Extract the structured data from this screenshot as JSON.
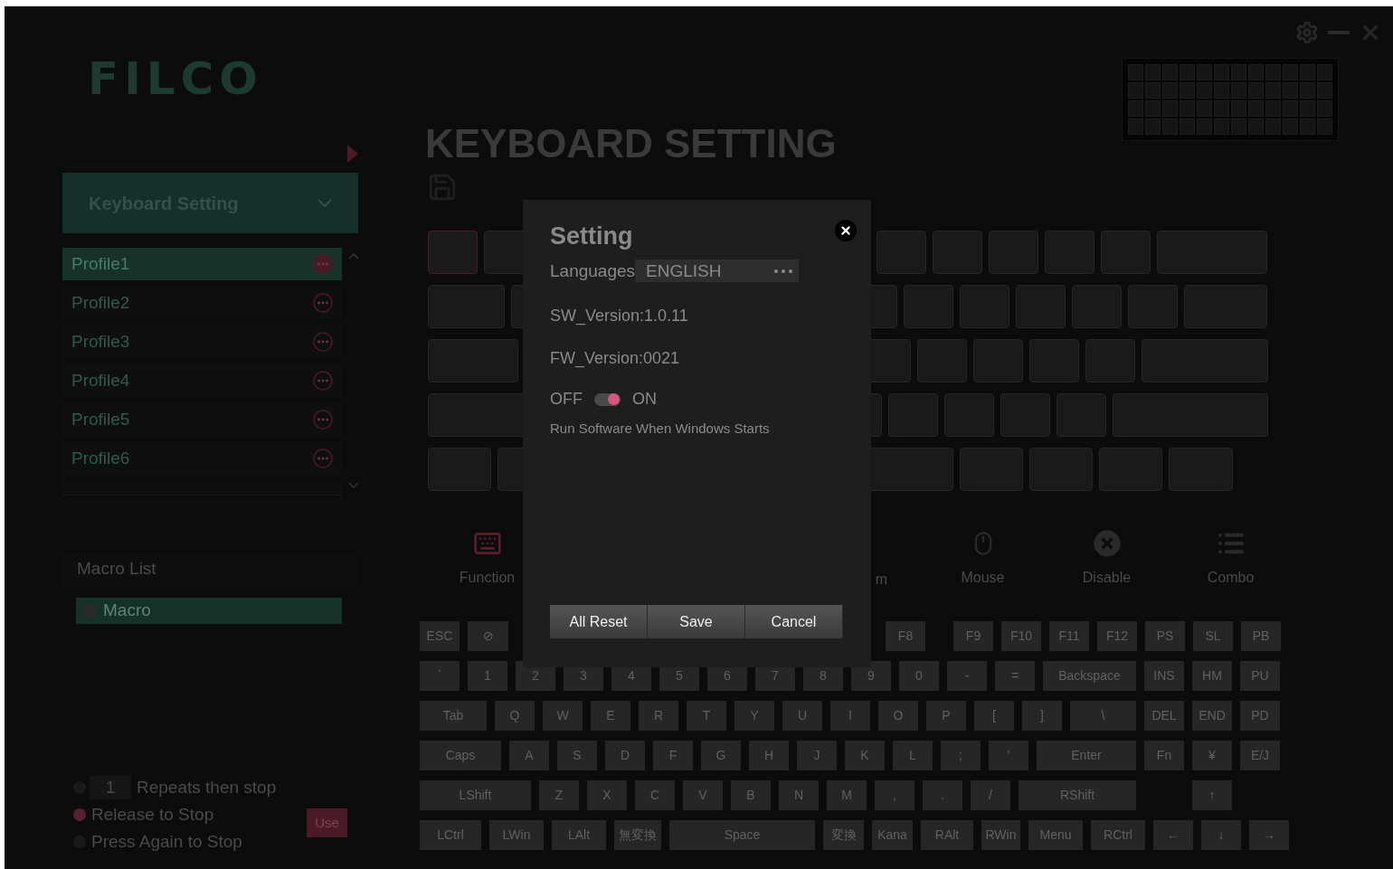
{
  "logo": "FILCO",
  "nav_dropdown": {
    "label": "Keyboard Setting"
  },
  "profiles": [
    {
      "name": "Profile1",
      "selected": true
    },
    {
      "name": "Profile2",
      "selected": false
    },
    {
      "name": "Profile3",
      "selected": false
    },
    {
      "name": "Profile4",
      "selected": false
    },
    {
      "name": "Profile5",
      "selected": false
    },
    {
      "name": "Profile6",
      "selected": false
    }
  ],
  "macro_list": {
    "title": "Macro List",
    "items": [
      {
        "name": "Macro",
        "selected": true
      }
    ]
  },
  "repeat_options": [
    {
      "kind": "count",
      "value": "1",
      "label": "Repeats then stop",
      "selected": false
    },
    {
      "kind": "plain",
      "label": "Release to Stop",
      "selected": true
    },
    {
      "kind": "plain",
      "label": "Press Again to Stop",
      "selected": false
    }
  ],
  "use_button": "Use",
  "page_title": "KEYBOARD SETTING",
  "function_tabs": [
    {
      "kind": "visible",
      "label": "Function",
      "selected": true
    },
    {
      "kind": "covered"
    },
    {
      "kind": "covered"
    },
    {
      "kind": "partial",
      "label": "m"
    },
    {
      "kind": "visible",
      "label": "Mouse",
      "selected": false
    },
    {
      "kind": "visible",
      "label": "Disable",
      "selected": false
    },
    {
      "kind": "visible",
      "label": "Combo",
      "selected": false
    }
  ],
  "keyboard_rows": [
    [
      "ESC",
      "⊘",
      null,
      "F8",
      null,
      "F9",
      "F10",
      "F11",
      "F12",
      "PS",
      "SL",
      "PB"
    ],
    [
      "`",
      "1",
      "2",
      "3",
      "4",
      "5",
      "6",
      "7",
      "8",
      "9",
      "0",
      "-",
      "=",
      "Backspace",
      "INS",
      "HM",
      "PU"
    ],
    [
      "Tab",
      "Q",
      "W",
      "E",
      "R",
      "T",
      "Y",
      "U",
      "I",
      "O",
      "P",
      "[",
      "]",
      "\\",
      "DEL",
      "END",
      "PD"
    ],
    [
      "Caps",
      "A",
      "S",
      "D",
      "F",
      "G",
      "H",
      "J",
      "K",
      "L",
      ";",
      "'",
      "Enter",
      "Fn",
      "¥",
      "E/J"
    ],
    [
      "LShift",
      "Z",
      "X",
      "C",
      "V",
      "B",
      "N",
      "M",
      ",",
      ".",
      "/",
      "RShift",
      null,
      "↑"
    ],
    [
      "LCtrl",
      "LWin",
      "LAlt",
      "無変換",
      "Space",
      "変換",
      "Kana",
      "RAlt",
      "RWin",
      "Menu",
      "RCtrl",
      "←",
      "↓",
      "→"
    ]
  ],
  "dialog": {
    "title": "Setting",
    "language_label": "Languages",
    "language_value": "ENGLISH",
    "sw_version": "SW_Version:1.0.11",
    "fw_version": "FW_Version:0021",
    "startup_toggle": {
      "off_label": "OFF",
      "on_label": "ON",
      "on": true,
      "caption": "Run Software When Windows Starts"
    },
    "buttons": [
      "All Reset",
      "Save",
      "Cancel"
    ]
  }
}
